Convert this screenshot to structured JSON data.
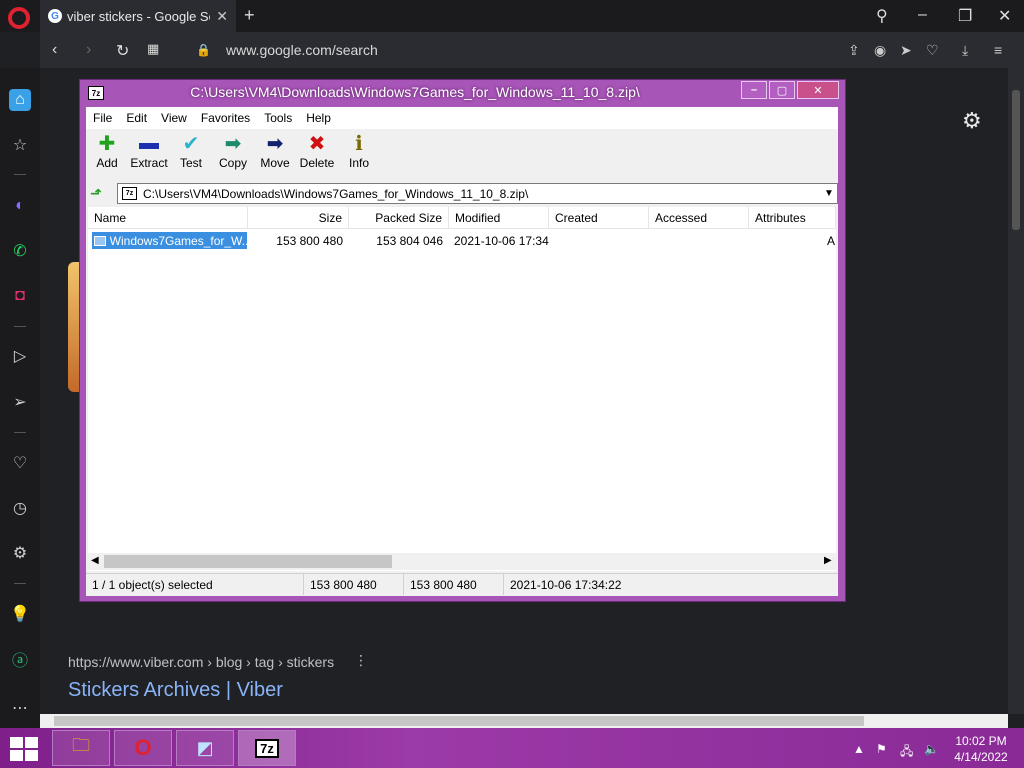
{
  "browser": {
    "tab_title": "viber stickers - Google Search",
    "tab_close": "✕",
    "new_tab": "+",
    "url": "www.google.com/search",
    "search_result": {
      "breadcrumb": "https://www.viber.com › blog › tag › stickers",
      "title": "Stickers Archives | Viber"
    }
  },
  "sevenzip": {
    "title": "C:\\Users\\VM4\\Downloads\\Windows7Games_for_Windows_11_10_8.zip\\",
    "title_icon": "7z",
    "menu": [
      "File",
      "Edit",
      "View",
      "Favorites",
      "Tools",
      "Help"
    ],
    "toolbar": [
      {
        "label": "Add",
        "icon": "add-icon",
        "glyph": "✚",
        "color": "#1fa31f"
      },
      {
        "label": "Extract",
        "icon": "extract-icon",
        "glyph": "▬",
        "color": "#1b2fb0"
      },
      {
        "label": "Test",
        "icon": "test-icon",
        "glyph": "✔",
        "color": "#2bb5c9"
      },
      {
        "label": "Copy",
        "icon": "copy-icon",
        "glyph": "➡",
        "color": "#1f8a6a"
      },
      {
        "label": "Move",
        "icon": "move-icon",
        "glyph": "➡",
        "color": "#12226e"
      },
      {
        "label": "Delete",
        "icon": "delete-icon",
        "glyph": "✖",
        "color": "#d21010"
      },
      {
        "label": "Info",
        "icon": "info-icon",
        "glyph": "ℹ",
        "color": "#7a6a00"
      }
    ],
    "path": "C:\\Users\\VM4\\Downloads\\Windows7Games_for_Windows_11_10_8.zip\\",
    "columns": [
      "Name",
      "Size",
      "Packed Size",
      "Modified",
      "Created",
      "Accessed",
      "Attributes"
    ],
    "rows": [
      {
        "name": "Windows7Games_for_W...",
        "size": "153 800 480",
        "packed": "153 804 046",
        "modified": "2021-10-06 17:34",
        "created": "",
        "accessed": "",
        "attributes": "A"
      }
    ],
    "status": {
      "selected": "1 / 1 object(s) selected",
      "size": "153 800 480",
      "packed": "153 800 480",
      "modified": "2021-10-06 17:34:22"
    }
  },
  "taskbar": {
    "time": "10:02 PM",
    "date": "4/14/2022",
    "sevenzip_label": "7z"
  }
}
